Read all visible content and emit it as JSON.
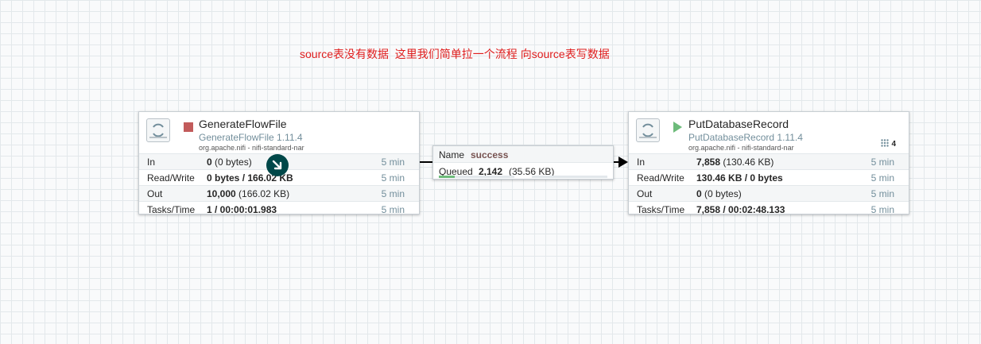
{
  "annotation": "source表没有数据  这里我们简单拉一个流程 向source表写数据",
  "processors": [
    {
      "name": "GenerateFlowFile",
      "type": "GenerateFlowFile 1.11.4",
      "bundle": "org.apache.nifi - nifi-standard-nar",
      "state": "stopped",
      "stats": {
        "in": {
          "label": "In",
          "count": "0",
          "size": "(0 bytes)",
          "time": "5 min"
        },
        "read_write": {
          "label": "Read/Write",
          "value": "0 bytes / 166.02 KB",
          "time": "5 min"
        },
        "out": {
          "label": "Out",
          "count": "10,000",
          "size": "(166.02 KB)",
          "time": "5 min"
        },
        "tasks": {
          "label": "Tasks/Time",
          "value": "1 / 00:00:01.983",
          "time": "5 min"
        }
      }
    },
    {
      "name": "PutDatabaseRecord",
      "type": "PutDatabaseRecord 1.11.4",
      "bundle": "org.apache.nifi - nifi-standard-nar",
      "state": "running",
      "badge": "4",
      "stats": {
        "in": {
          "label": "In",
          "count": "7,858",
          "size": "(130.46 KB)",
          "time": "5 min"
        },
        "read_write": {
          "label": "Read/Write",
          "value": "130.46 KB / 0 bytes",
          "time": "5 min"
        },
        "out": {
          "label": "Out",
          "count": "0",
          "size": "(0 bytes)",
          "time": "5 min"
        },
        "tasks": {
          "label": "Tasks/Time",
          "value": "7,858 / 00:02:48.133",
          "time": "5 min"
        }
      }
    }
  ],
  "connection": {
    "name_label": "Name",
    "name": "success",
    "queued_label": "Queued",
    "queued_count": "2,142",
    "queued_size": "(35.56 KB)"
  },
  "colors": {
    "annotation": "#e01e1e",
    "type_text": "#728e9b",
    "stopped": "#c25b5b",
    "running": "#6dbb7a",
    "handle": "#004849"
  }
}
